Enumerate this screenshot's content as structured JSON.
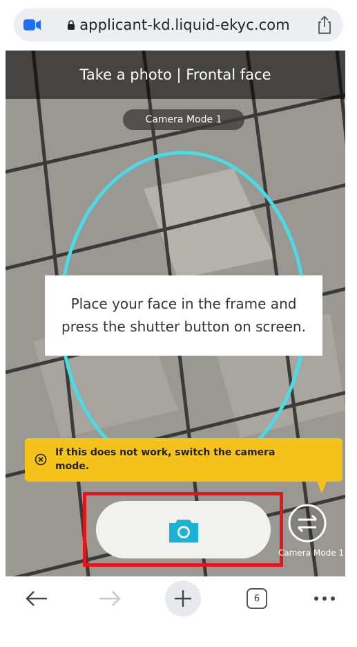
{
  "browser": {
    "url": "applicant-kd.liquid-ekyc.com",
    "tab_count": "6"
  },
  "camera": {
    "title": "Take a photo | Frontal face",
    "mode_pill": "Camera Mode 1",
    "instruction_line1": "Place your face in the frame and",
    "instruction_line2": "press the shutter button on screen.",
    "warning_line1": "If this does not work, switch the camera",
    "warning_line2": "mode.",
    "switch_label": "Camera Mode 1"
  },
  "colors": {
    "frame_ring": "#47dce6",
    "warning_bg": "#f5c21b",
    "shutter_icon": "#1ab3d6",
    "highlight": "#e8141a"
  },
  "icons": {
    "video": "video-camera-icon",
    "lock": "lock-icon",
    "share": "share-icon",
    "close_circle": "close-circle-icon",
    "camera": "camera-icon",
    "switch": "switch-arrows-icon",
    "back": "back-arrow-icon",
    "forward": "forward-arrow-icon",
    "new_tab": "plus-icon",
    "tabs": "tabs-icon",
    "more": "more-dots-icon"
  }
}
